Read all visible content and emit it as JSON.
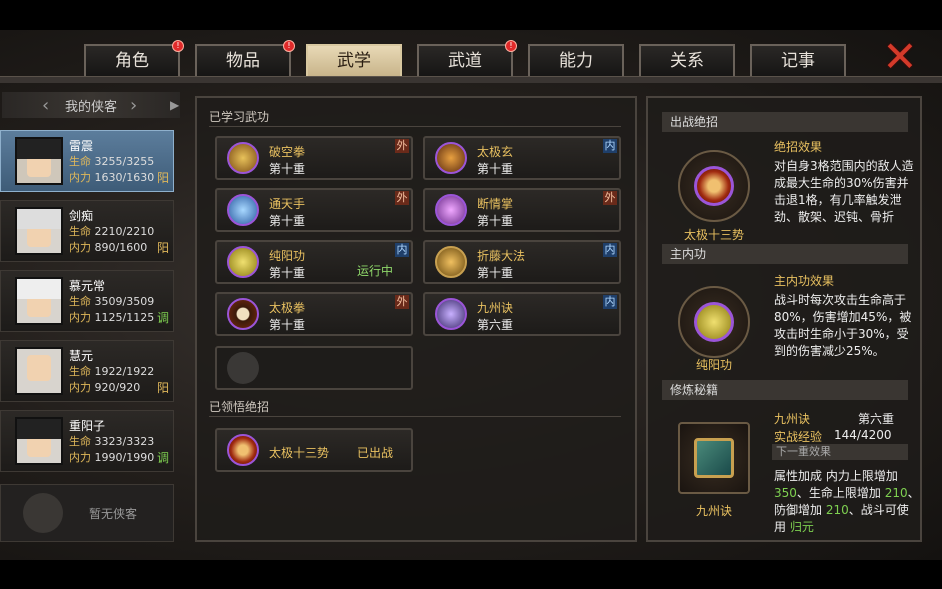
{
  "tabs": [
    {
      "label": "角色",
      "badge": true
    },
    {
      "label": "物品",
      "badge": true
    },
    {
      "label": "武学",
      "badge": false,
      "active": true
    },
    {
      "label": "武道",
      "badge": true
    },
    {
      "label": "能力",
      "badge": false
    },
    {
      "label": "关系",
      "badge": false
    },
    {
      "label": "记事",
      "badge": false
    }
  ],
  "close_glyph": "✕",
  "roster": {
    "title": "我的侠客",
    "heroes": [
      {
        "name": "雷震",
        "hp_label": "生命",
        "hp": "3255/3255",
        "mp_label": "内力",
        "mp": "1630/1630",
        "yy": "阳",
        "yy_color": "#e0b85a"
      },
      {
        "name": "剑痴",
        "hp_label": "生命",
        "hp": "2210/2210",
        "mp_label": "内力",
        "mp": "890/1600",
        "yy": "阳",
        "yy_color": "#e0b85a"
      },
      {
        "name": "慕元常",
        "hp_label": "生命",
        "hp": "3509/3509",
        "mp_label": "内力",
        "mp": "1125/1125",
        "yy": "调",
        "yy_color": "#7ed050"
      },
      {
        "name": "慧元",
        "hp_label": "生命",
        "hp": "1922/1922",
        "mp_label": "内力",
        "mp": "920/920",
        "yy": "阳",
        "yy_color": "#e0b85a"
      },
      {
        "name": "重阳子",
        "hp_label": "生命",
        "hp": "3323/3323",
        "mp_label": "内力",
        "mp": "1990/1990",
        "yy": "调",
        "yy_color": "#7ed050"
      }
    ],
    "empty_label": "暂无侠客"
  },
  "learned": {
    "title": "已学习武功",
    "skills": [
      {
        "name": "破空拳",
        "level": "第十重",
        "tag": "外"
      },
      {
        "name": "太极玄",
        "level": "第十重",
        "tag": "内"
      },
      {
        "name": "通天手",
        "level": "第十重",
        "tag": "外"
      },
      {
        "name": "断情掌",
        "level": "第十重",
        "tag": "外"
      },
      {
        "name": "纯阳功",
        "level": "第十重",
        "tag": "内",
        "status": "运行中"
      },
      {
        "name": "折藤大法",
        "level": "第十重",
        "tag": "内"
      },
      {
        "name": "太极拳",
        "level": "第十重",
        "tag": "外"
      },
      {
        "name": "九州诀",
        "level": "第六重",
        "tag": "内"
      }
    ]
  },
  "ultimate": {
    "title": "已领悟绝招",
    "name": "太极十三势",
    "status": "已出战"
  },
  "right": {
    "battle": {
      "header": "出战绝招",
      "icon_label": "太极十三势",
      "effect_title": "绝招效果",
      "effect_text": "对自身3格范围内的敌人造成最大生命的30%伤害并击退1格，有几率触发泄劲、散架、迟钝、骨折"
    },
    "inner": {
      "header": "主内功",
      "icon_label": "纯阳功",
      "effect_title": "主内功效果",
      "effect_text": "战斗时每次攻击生命高于80%，伤害增加45%，被攻击时生命小于30%，受到的伤害减少25%。"
    },
    "book": {
      "header": "修炼秘籍",
      "icon_label": "九州诀",
      "name": "九州诀",
      "level": "第六重",
      "exp_label": "实战经验",
      "exp": "144/4200",
      "next_label": "下一重效果",
      "attr_a": "属性加成 内力上限增加",
      "val_a": "350",
      "attr_b": "、生命上限增加",
      "val_b": "210",
      "attr_c": "、防御增加",
      "val_c": "210",
      "attr_d": "、战斗可使用",
      "attr_e": "归元"
    }
  }
}
